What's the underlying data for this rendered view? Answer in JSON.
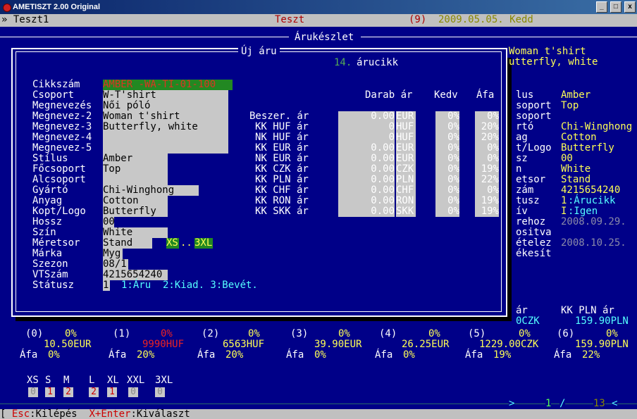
{
  "window": {
    "title": "AMETISZT 2.00 Original",
    "min": "_",
    "restore": "□",
    "close": "x"
  },
  "menubar": {
    "left": "» Teszt1",
    "center": "Teszt",
    "count": "(9)",
    "date": "2009.05.05. Kedd"
  },
  "panel": {
    "title": "Árukészlet"
  },
  "dialog": {
    "title": "Új áru",
    "counter": "14.",
    "counter_label": "árucikk"
  },
  "fields": [
    {
      "label": "Cikkszám",
      "value": "AMBER -WA-TI-01-100"
    },
    {
      "label": "Csoport",
      "value": "W-T'shirt"
    },
    {
      "label": "Megnevezés",
      "value": "Női póló"
    },
    {
      "label": "Megnevez-2",
      "value": "Woman t'shirt"
    },
    {
      "label": "Megnevez-3",
      "value": "Butterfly, white"
    },
    {
      "label": "Megnevez-4",
      "value": ""
    },
    {
      "label": "Megnevez-5",
      "value": ""
    },
    {
      "label": "Stílus",
      "value": "Amber"
    },
    {
      "label": "Főcsoport",
      "value": "Top"
    },
    {
      "label": "Alcsoport",
      "value": ""
    },
    {
      "label": "Gyártó",
      "value": "Chi-Winghong"
    },
    {
      "label": "Anyag",
      "value": "Cotton"
    },
    {
      "label": "Kopt/Logo",
      "value": "Butterfly"
    },
    {
      "label": "Hossz",
      "value": "00"
    },
    {
      "label": "Szín",
      "value": "White"
    },
    {
      "label": "Méretsor",
      "value": "Stand"
    },
    {
      "label": "Márka",
      "value": "Myg"
    },
    {
      "label": "Szezon",
      "value": "08/1"
    },
    {
      "label": "VTSzám",
      "value": "4215654240"
    },
    {
      "label": "Státusz",
      "value": "1"
    }
  ],
  "size_range": {
    "from": "XS",
    "sep": "..",
    "to": "3XL"
  },
  "status_hint": "1:Áru  2:Kiad. 3:Bevét.",
  "price_headers": {
    "darab_ar": "Darab ár",
    "kedv": "Kedv",
    "afa": "Áfa"
  },
  "price_rows": [
    {
      "label": "Beszer. ár",
      "value": "0.00",
      "cur": "EUR",
      "kedv": "0%",
      "afa": "0%"
    },
    {
      "label": "KK HUF ár",
      "value": "0",
      "cur": "HUF",
      "kedv": "0%",
      "afa": "20%"
    },
    {
      "label": "NK HUF ár",
      "value": "0",
      "cur": "HUF",
      "kedv": "0%",
      "afa": "20%"
    },
    {
      "label": "KK EUR ár",
      "value": "0.00",
      "cur": "EUR",
      "kedv": "0%",
      "afa": "0%"
    },
    {
      "label": "NK EUR ár",
      "value": "0.00",
      "cur": "EUR",
      "kedv": "0%",
      "afa": "0%"
    },
    {
      "label": "KK CZK ár",
      "value": "0.00",
      "cur": "CZK",
      "kedv": "0%",
      "afa": "19%"
    },
    {
      "label": "KK PLN ár",
      "value": "0.00",
      "cur": "PLN",
      "kedv": "0%",
      "afa": "22%"
    },
    {
      "label": "KK CHF ár",
      "value": "0.00",
      "cur": "CHF",
      "kedv": "0%",
      "afa": "0%"
    },
    {
      "label": "KK RON ár",
      "value": "0.00",
      "cur": "RON",
      "kedv": "0%",
      "afa": "19%"
    },
    {
      "label": "KK SKK ár",
      "value": "0.00",
      "cur": "SKK",
      "kedv": "0%",
      "afa": "19%"
    }
  ],
  "right_panel": {
    "line1": "Woman t'shirt",
    "line2": "utterfly, white",
    "rows": [
      {
        "label": "lus",
        "value": "Amber"
      },
      {
        "label": "soport",
        "value": "Top"
      },
      {
        "label": "soport",
        "value": ""
      },
      {
        "label": "rtó",
        "value": "Chi-Winghong"
      },
      {
        "label": "ag",
        "value": "Cotton"
      },
      {
        "label": "t/Logo",
        "value": "Butterfly"
      },
      {
        "label": "sz",
        "value": "00"
      },
      {
        "label": "n",
        "value": "White"
      },
      {
        "label": "etsor",
        "value": "Stand"
      },
      {
        "label": "zám",
        "value": "4215654240"
      },
      {
        "label": "tusz",
        "value": "1",
        "extra": ":Árucikk"
      },
      {
        "label": "ív",
        "value": "I",
        "extra": ":Igen"
      },
      {
        "label": "rehoz",
        "value": "2008.09.29."
      },
      {
        "label": "ositva",
        "value": ""
      },
      {
        "label": "ételez",
        "value": "2008.10.25."
      },
      {
        "label": "ékesít",
        "value": ""
      }
    ],
    "bottom_label": "ár",
    "bottom_czk": "0CZK",
    "bottom_pln_label": "KK PLN ár",
    "bottom_pln_value": "159.90PLN"
  },
  "price_columns": [
    {
      "idx": "(0)",
      "pct": "0%",
      "price": "10.50EUR",
      "afa_label": "Áfa",
      "afa": "0%"
    },
    {
      "idx": "(1)",
      "pct": "0%",
      "price": "9990HUF",
      "afa_label": "Áfa",
      "afa": "20%"
    },
    {
      "idx": "(2)",
      "pct": "0%",
      "price": "6563HUF",
      "afa_label": "Áfa",
      "afa": "20%"
    },
    {
      "idx": "(3)",
      "pct": "0%",
      "price": "39.90EUR",
      "afa_label": "Áfa",
      "afa": "0%"
    },
    {
      "idx": "(4)",
      "pct": "0%",
      "price": "26.25EUR",
      "afa_label": "Áfa",
      "afa": "0%"
    },
    {
      "idx": "(5)",
      "pct": "0%",
      "price": "1229.00CZK",
      "afa_label": "Áfa",
      "afa": "19%"
    },
    {
      "idx": "(6)",
      "pct": "0%",
      "price": "159.90PLN",
      "afa_label": "Áfa",
      "afa": "22%"
    }
  ],
  "sizes": [
    {
      "label": "XS",
      "qty": "0"
    },
    {
      "label": "S",
      "qty": "1"
    },
    {
      "label": "M",
      "qty": "2"
    },
    {
      "label": "L",
      "qty": "2"
    },
    {
      "label": "XL",
      "qty": "1"
    },
    {
      "label": "XXL",
      "qty": "0"
    },
    {
      "label": "3XL",
      "qty": "0"
    }
  ],
  "pager": {
    "arrow_right": ">",
    "current": "1",
    "sep": "/",
    "total": "13",
    "arrow_left": "<"
  },
  "statusbar": {
    "bracket": "[",
    "esc_key": "Esc",
    "esc_label": ":Kilépés",
    "enter_key": "X+Enter",
    "enter_label": ":Kiválaszt"
  },
  "colors": {
    "background": "#000088",
    "highlight": "#55ffff",
    "accent": "#ffff55",
    "error": "#ee2222"
  }
}
